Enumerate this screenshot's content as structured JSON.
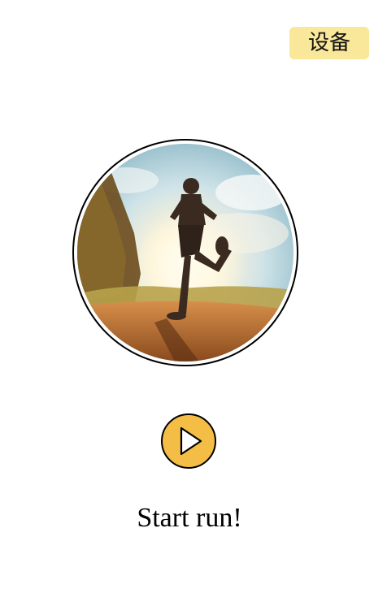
{
  "header": {
    "device_button_label": "设备"
  },
  "hero": {
    "image_subject": "runner-on-trail-at-sunset",
    "icon": "runner-photo"
  },
  "controls": {
    "play_icon": "play-icon"
  },
  "caption": {
    "text": "Start run!"
  },
  "colors": {
    "device_button_bg": "#f9e79a",
    "play_button_bg": "#f4bd46",
    "frame_border": "#000000"
  }
}
